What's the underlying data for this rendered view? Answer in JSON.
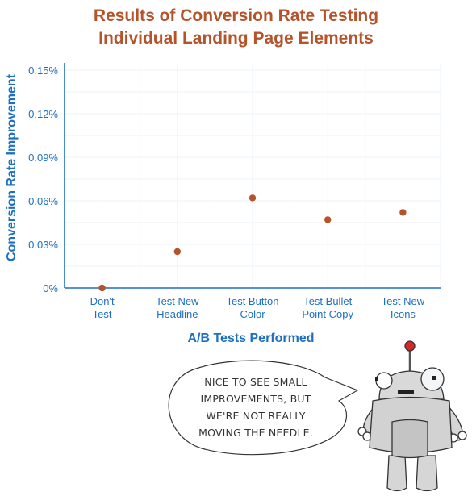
{
  "chart_data": {
    "type": "scatter",
    "title": [
      "Results of Conversion Rate Testing",
      "Individual Landing Page Elements"
    ],
    "xlabel": "A/B Tests Performed",
    "ylabel": "Conversion Rate Improvement",
    "categories": [
      [
        "Don't",
        "Test"
      ],
      [
        "Test New",
        "Headline"
      ],
      [
        "Test Button",
        "Color"
      ],
      [
        "Test Bullet",
        "Point Copy"
      ],
      [
        "Test New",
        "Icons"
      ]
    ],
    "values": [
      0.0,
      0.025,
      0.062,
      0.047,
      0.052
    ],
    "value_unit": "%",
    "ylim": [
      0,
      0.15
    ],
    "yticks": [
      0,
      0.03,
      0.06,
      0.09,
      0.12,
      0.15
    ],
    "ytick_labels": [
      "0%",
      "0.03%",
      "0.06%",
      "0.09%",
      "0.12%",
      "0.15%"
    ],
    "grid": true,
    "legend": "none",
    "colors": {
      "title": "#B5532A",
      "point": "#B5532A",
      "axis": "#1E6FC2",
      "grid": "#EEF3F8"
    }
  },
  "annotation": {
    "speech_bubble_lines": [
      "NICE TO SEE SMALL",
      "IMPROVEMENTS, BUT",
      "WE'RE NOT REALLY",
      "MOVING THE NEEDLE."
    ],
    "character": "robot-mascot"
  }
}
